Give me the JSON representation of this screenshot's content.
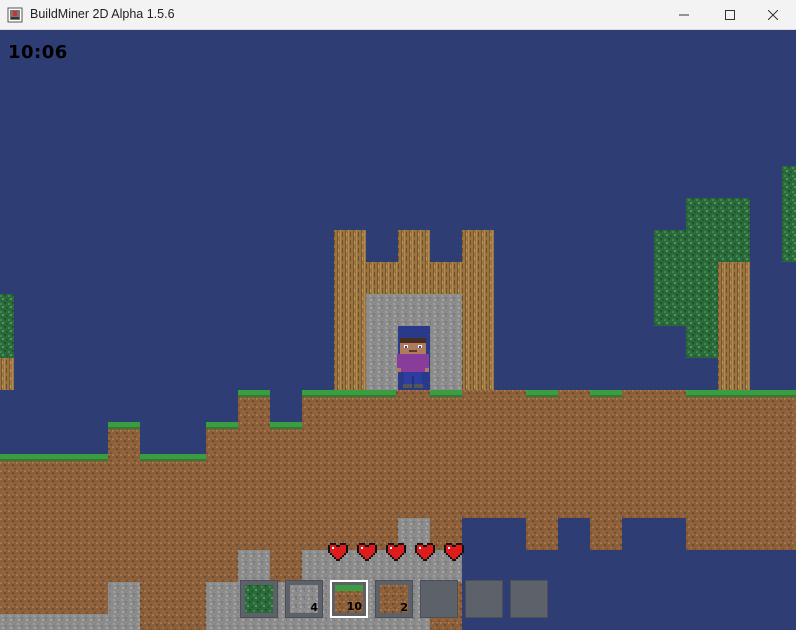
{
  "window": {
    "title": "BuildMiner 2D Alpha 1.5.6"
  },
  "hud": {
    "clock": "10:06",
    "health": 5,
    "max_health": 5,
    "hotbar": [
      {
        "item": "leaves-block",
        "count": ""
      },
      {
        "item": "stone-block",
        "count": "4"
      },
      {
        "item": "grass-block",
        "count": "10",
        "selected": true
      },
      {
        "item": "dirt-block",
        "count": "2"
      },
      {
        "item": "",
        "count": ""
      },
      {
        "item": "",
        "count": ""
      },
      {
        "item": "",
        "count": ""
      }
    ]
  },
  "colors": {
    "sky": "#2e3d73",
    "dirt": "#8b5f3a",
    "grass": "#3a9d3f",
    "stone": "#8c8c8c",
    "wood": "#9a7440",
    "leaves": "#2c6a3c",
    "heart": "#e01b1b",
    "slot": "#5d6169"
  },
  "icons": [
    "app-icon",
    "minimize-icon",
    "maximize-icon",
    "close-icon",
    "heart-icon"
  ]
}
